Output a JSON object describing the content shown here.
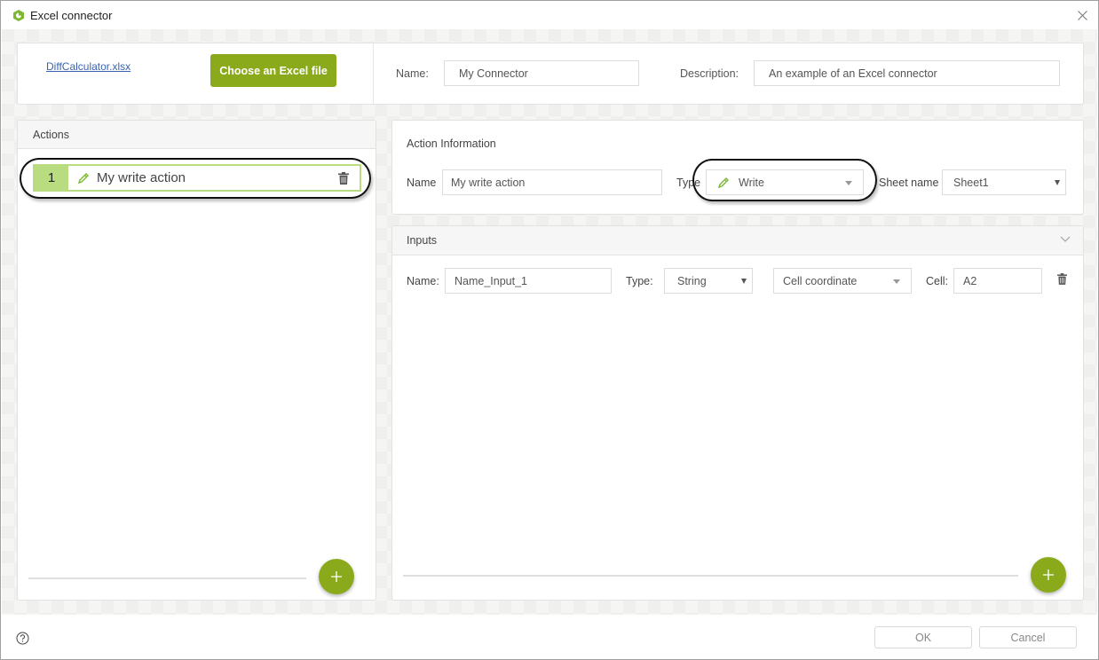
{
  "window": {
    "title": "Excel connector",
    "app_icon": "connector-logo-icon",
    "close_icon": "close-icon"
  },
  "file": {
    "link_text": "DiffCalculator.xlsx",
    "choose_button_label": "Choose an Excel file"
  },
  "connector": {
    "name_label": "Name:",
    "name_value": "My Connector",
    "description_label": "Description:",
    "description_value": "An example of an Excel connector"
  },
  "actions": {
    "header": "Actions",
    "items": [
      {
        "number": "1",
        "label": "My write action",
        "icon": "pencil-icon",
        "selected": true
      }
    ],
    "add_button_icon": "plus-icon"
  },
  "action_information": {
    "title": "Action Information",
    "name_label": "Name",
    "name_value": "My write action",
    "type_label": "Type",
    "type_value": "Write",
    "sheet_label": "Sheet name",
    "sheet_value": "Sheet1"
  },
  "inputs": {
    "header": "Inputs",
    "rows": [
      {
        "name_label": "Name:",
        "name_value": "Name_Input_1",
        "type_label": "Type:",
        "type_value": "String",
        "mode_value": "Cell coordinate",
        "cell_label": "Cell:",
        "cell_value": "A2"
      }
    ],
    "add_button_icon": "plus-icon"
  },
  "footer": {
    "help_icon": "help-icon",
    "ok_label": "OK",
    "cancel_label": "Cancel"
  },
  "colors": {
    "accent": "#8aaa1c",
    "selected_item": "#b9dc80",
    "link": "#3a64b0"
  }
}
